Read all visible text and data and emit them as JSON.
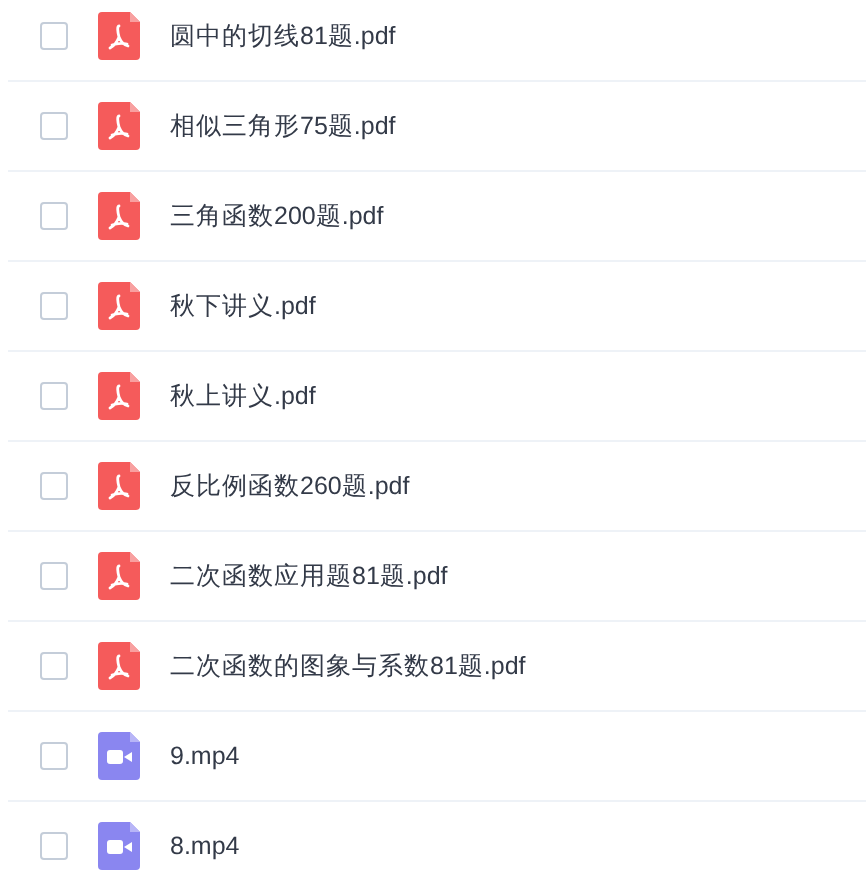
{
  "files": [
    {
      "name": "圆中的切线81题.pdf",
      "kind": "pdf",
      "checked": false
    },
    {
      "name": "相似三角形75题.pdf",
      "kind": "pdf",
      "checked": false
    },
    {
      "name": "三角函数200题.pdf",
      "kind": "pdf",
      "checked": false
    },
    {
      "name": "秋下讲义.pdf",
      "kind": "pdf",
      "checked": false
    },
    {
      "name": "秋上讲义.pdf",
      "kind": "pdf",
      "checked": false
    },
    {
      "name": "反比例函数260题.pdf",
      "kind": "pdf",
      "checked": false
    },
    {
      "name": "二次函数应用题81题.pdf",
      "kind": "pdf",
      "checked": false
    },
    {
      "name": "二次函数的图象与系数81题.pdf",
      "kind": "pdf",
      "checked": false
    },
    {
      "name": "9.mp4",
      "kind": "video",
      "checked": false
    },
    {
      "name": "8.mp4",
      "kind": "video",
      "checked": false
    }
  ]
}
